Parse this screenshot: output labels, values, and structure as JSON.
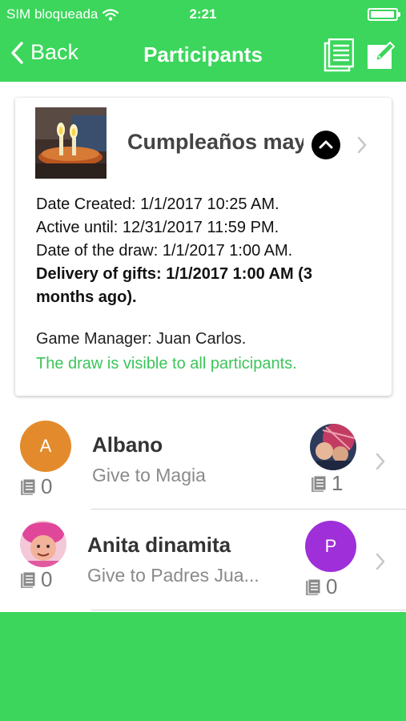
{
  "status_bar": {
    "carrier": "SIM bloqueada",
    "time": "2:21"
  },
  "nav": {
    "back_label": "Back",
    "title": "Participants"
  },
  "event": {
    "title": "Cumpleaños may",
    "date_created": "Date Created: 1/1/2017 10:25 AM.",
    "active_until": "Active until: 12/31/2017 11:59 PM.",
    "draw_date": "Date of the draw: 1/1/2017 1:00 AM.",
    "delivery": "Delivery of gifts: 1/1/2017 1:00 AM (3 months ago).",
    "manager": "Game Manager: Juan Carlos.",
    "visibility": "The draw is visible to all participants."
  },
  "participants": [
    {
      "name": "Albano",
      "initial": "A",
      "avatar_color": "#e38b2c",
      "give_to": "Give to Magia",
      "own_count": "0",
      "target_count": "1"
    },
    {
      "name": "Anita dinamita",
      "give_to": "Give to Padres Jua...",
      "target_initial": "P",
      "target_color": "#9f2fd8",
      "own_count": "0",
      "target_count": "0"
    }
  ],
  "colors": {
    "accent": "#3bd65b",
    "success_text": "#3bc55a"
  }
}
